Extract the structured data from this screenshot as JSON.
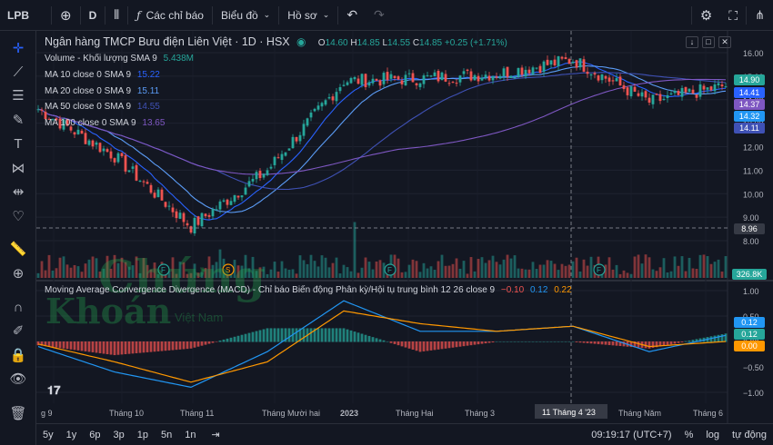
{
  "toolbar": {
    "symbol": "LPB",
    "interval": "D",
    "indicators_label": "Các chỉ báo",
    "chart_type_label": "Biểu đồ",
    "profile_label": "Hồ sơ"
  },
  "legend": {
    "title": "Ngân hàng TMCP Bưu điện Liên Việt · 1D · HSX",
    "o_key": "O",
    "o": "14.60",
    "h_key": "H",
    "h": "14.85",
    "l_key": "L",
    "l": "14.55",
    "c_key": "C",
    "c": "14.85",
    "change": "+0.25 (+1.71%)",
    "volume_label": "Volume - Khối lượng SMA 9",
    "volume_value": "5.438M",
    "ma10_label": "MA 10 close 0 SMA 9",
    "ma10_value": "15.22",
    "ma20_label": "MA 20 close 0 SMA 9",
    "ma20_value": "15.11",
    "ma50_label": "MA 50 close 0 SMA 9",
    "ma50_value": "14.55",
    "ma100_label": "MA 100 close 0 SMA 9",
    "ma100_value": "13.65",
    "macd_label": "Moving Average Convergence Divergence (MACD) - Chỉ báo Biến động Phân kỳ/Hội tụ trung bình 12 26 close 9",
    "macd_v1": "−0.10",
    "macd_v2": "0.12",
    "macd_v3": "0.22"
  },
  "price_axis": [
    "16.00",
    "15.00",
    "14.00",
    "13.00",
    "12.00",
    "11.00",
    "10.00",
    "9.00",
    "8.00"
  ],
  "price_tags": {
    "close": "14.90",
    "ma10": "14.41",
    "ma20": "14.37",
    "ma50": "14.32",
    "ma100": "14.11",
    "crosshair": "8.96",
    "volume": "326.8K"
  },
  "macd_axis": [
    "1.00",
    "0.50",
    "0.00",
    "−0.50",
    "−1.00"
  ],
  "macd_tags": {
    "hist": "0.12",
    "macd": "0.12",
    "signal": "0.00"
  },
  "time_axis": [
    "g 9",
    "Tháng 10",
    "Tháng 11",
    "Tháng Mười hai",
    "2023",
    "Tháng Hai",
    "Tháng 3",
    "Tháng Năm",
    "Tháng 6"
  ],
  "crosshair_date": "11 Tháng 4 '23",
  "bottom": {
    "ranges": [
      "5y",
      "1y",
      "6p",
      "3p",
      "1p",
      "5n",
      "1n"
    ],
    "clock": "09:19:17 (UTC+7)",
    "pct": "%",
    "log": "log",
    "auto": "tự động"
  },
  "watermark": {
    "line1": "Chứng",
    "line2": "Khoán",
    "line3": "Việt Nam"
  },
  "colors": {
    "up": "#26a69a",
    "down": "#ef5350",
    "ma10": "#2962ff",
    "ma20": "#5b9cf6",
    "ma50": "#3f51b5",
    "ma100": "#7e57c2",
    "macd": "#2196f3",
    "signal": "#ff9800"
  },
  "chart_data": [
    {
      "type": "line",
      "title": "Ngân hàng TMCP Bưu điện Liên Việt · 1D · HSX",
      "x": [
        "Sep 2022",
        "Oct 2022",
        "Nov 2022",
        "Dec 2022",
        "Jan 2023",
        "Feb 2023",
        "Mar 2023",
        "Apr 2023",
        "May 2023",
        "Jun 2023"
      ],
      "series": [
        {
          "name": "close",
          "values": [
            13.6,
            11.6,
            8.6,
            11.0,
            14.8,
            14.9,
            15.1,
            15.7,
            13.9,
            14.6
          ]
        }
      ],
      "ylim": [
        8,
        16
      ],
      "grid": true
    },
    {
      "type": "line",
      "title": "Moving Average Convergence Divergence (MACD)",
      "x": [
        "Sep 2022",
        "Oct 2022",
        "Nov 2022",
        "Dec 2022",
        "Jan 2023",
        "Feb 2023",
        "Mar 2023",
        "Apr 2023",
        "May 2023",
        "Jun 2023"
      ],
      "series": [
        {
          "name": "MACD",
          "values": [
            -0.1,
            -0.6,
            -0.9,
            -0.2,
            0.8,
            0.2,
            0.2,
            0.3,
            -0.2,
            0.12
          ]
        },
        {
          "name": "Signal",
          "values": [
            -0.05,
            -0.4,
            -0.8,
            -0.4,
            0.6,
            0.35,
            0.2,
            0.3,
            -0.1,
            0.0
          ]
        }
      ],
      "ylim": [
        -1.2,
        1.2
      ],
      "grid": true
    }
  ]
}
